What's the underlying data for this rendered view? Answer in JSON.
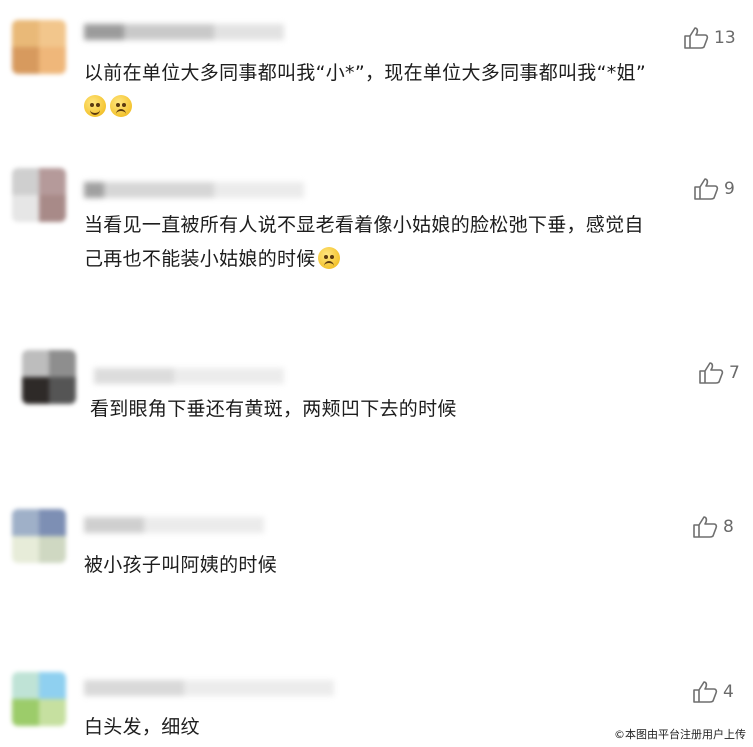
{
  "comments": [
    {
      "likes": "13",
      "text": "以前在单位大多同事都叫我“小*”，现在单位大多同事都叫我“*姐”",
      "emojis": [
        "smile-emoji",
        "awkward-emoji"
      ]
    },
    {
      "likes": "9",
      "text_line1": "当看见一直被所有人说不显老看着像小姑娘的脸松弛下垂，感觉自",
      "text_line2": "己再也不能装小姑娘的时候",
      "emojis": [
        "awkward-emoji"
      ]
    },
    {
      "likes": "7",
      "text": "看到眼角下垂还有黄斑，两颊凹下去的时候"
    },
    {
      "likes": "8",
      "text": "被小孩子叫阿姨的时候"
    },
    {
      "likes": "4",
      "text": "白头发，细纹"
    }
  ],
  "watermark": "©本图由平台注册用户上传",
  "icons": {
    "like": "thumbs-up-icon"
  }
}
